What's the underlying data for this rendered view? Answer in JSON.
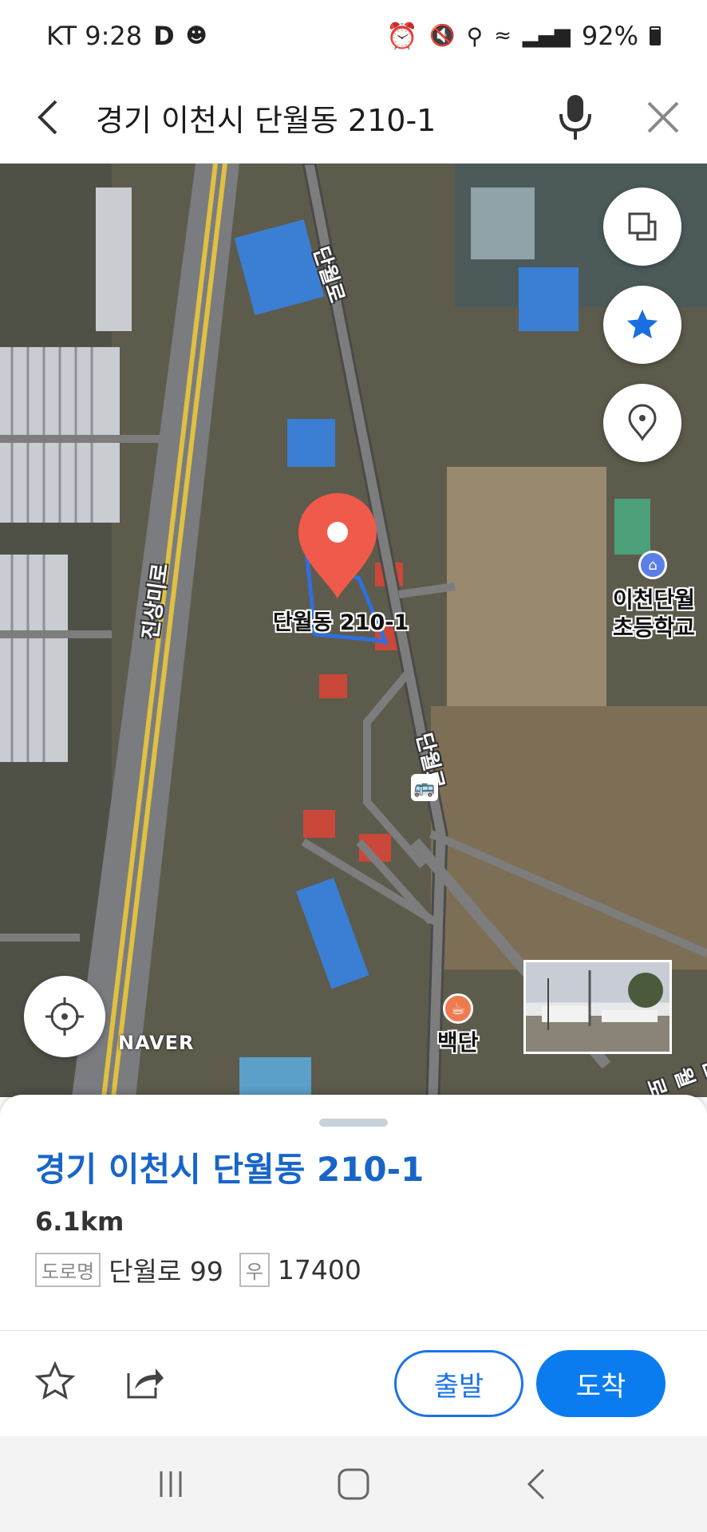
{
  "status": {
    "carrier_time": "KT 9:28",
    "battery": "92%"
  },
  "search": {
    "query": "경기 이천시 단월동 210-1"
  },
  "map": {
    "road_labels": [
      "단월로",
      "진상미로",
      "단월로",
      "단월로"
    ],
    "pin_label": "단월동 210-1",
    "school_line1": "이천단월",
    "school_line2": "초등학교",
    "poi_baekdan": "백단",
    "watermark": "NAVER"
  },
  "sheet": {
    "title": "경기 이천시 단월동 210-1",
    "distance": "6.1km",
    "road_tag": "도로명",
    "road_address": "단월로 99",
    "postal_tag": "우",
    "postal_code": "17400"
  },
  "actions": {
    "depart": "출발",
    "arrive": "도착"
  },
  "colors": {
    "accent": "#0a7cf0",
    "title": "#1865c8",
    "pin": "#f05a4a"
  }
}
